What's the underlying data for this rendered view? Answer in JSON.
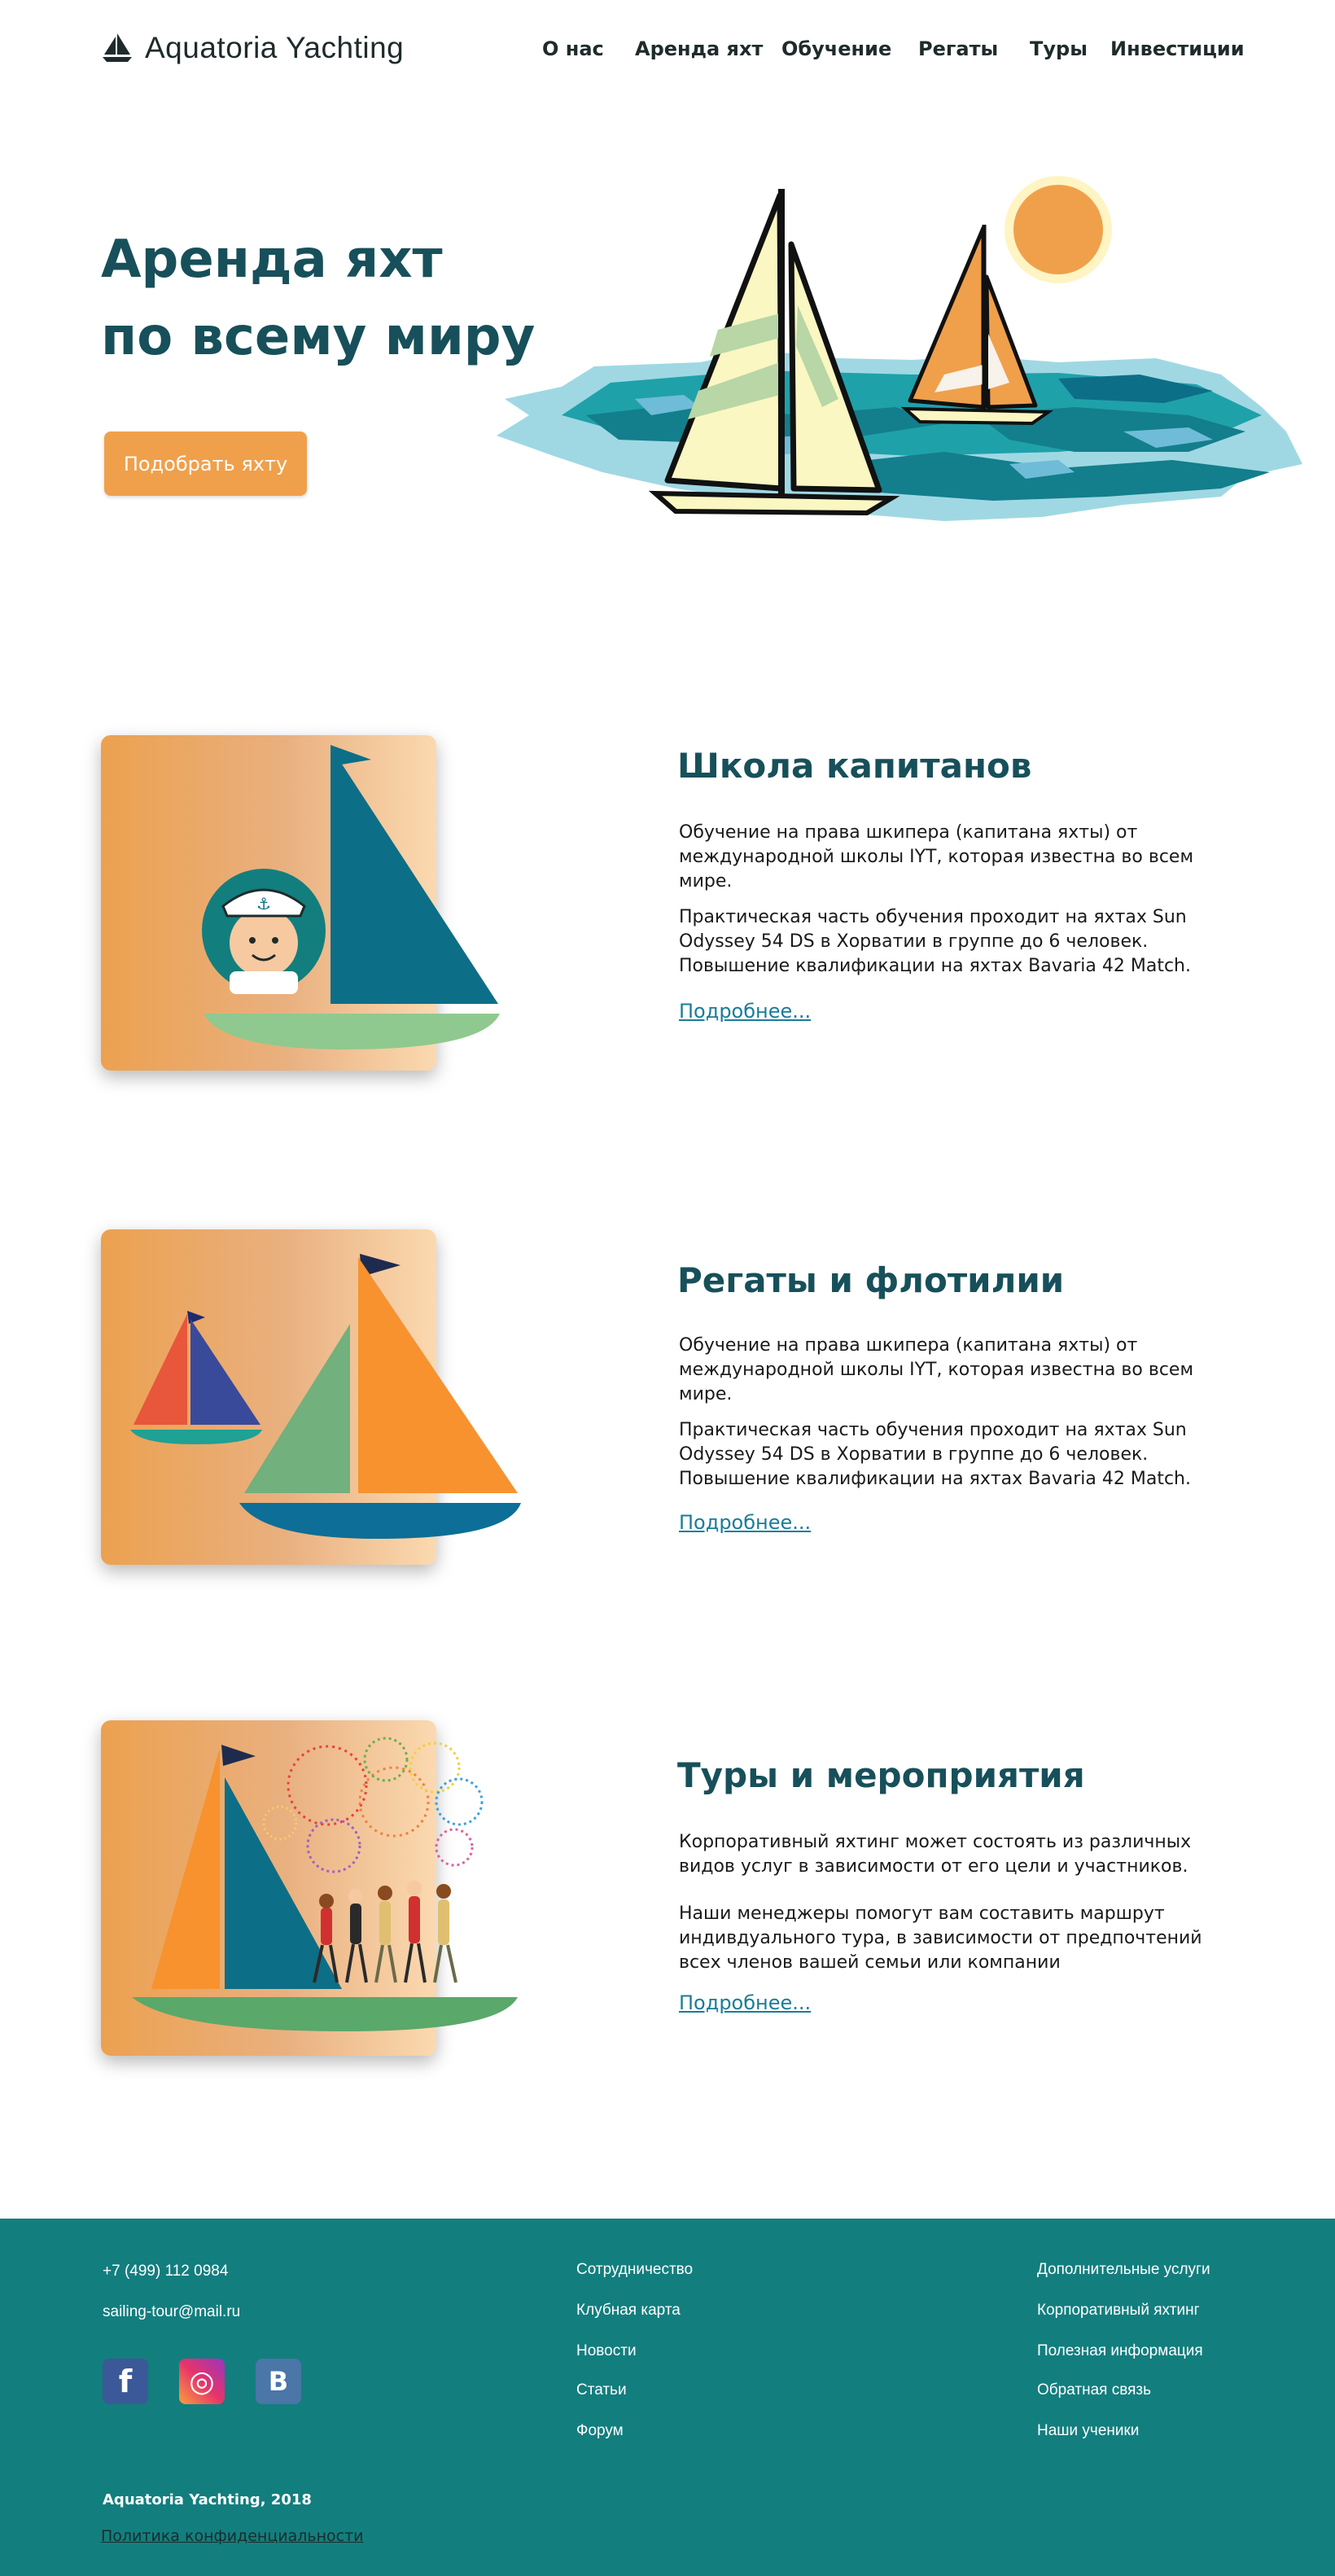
{
  "header": {
    "logo_text": "Aquatoria Yachting",
    "nav": [
      "О нас",
      "Аренда яхт",
      "Обучение",
      "Регаты",
      "Туры",
      "Инвестиции"
    ]
  },
  "hero": {
    "title_line1": "Аренда яхт",
    "title_line2": "по всему миру",
    "button": "Подобрать яхту"
  },
  "sections": [
    {
      "title": "Школа капитанов",
      "paragraphs": [
        "Обучение на права шкипера (капитана яхты) от международной школы IYT, которая известна во всем мире.",
        "Практическая часть обучения проходит на яхтах Sun Odyssey 54 DS в Хорватии в группе до 6 человек. Повышение квалификации на яхтах Bavaria 42 Match."
      ],
      "link": "Подробнее..."
    },
    {
      "title": "Регаты и флотилии",
      "paragraphs": [
        "Обучение на права шкипера (капитана яхты) от международной школы IYT, которая известна во всем мире.",
        "Практическая часть обучения проходит на яхтах Sun Odyssey 54 DS в Хорватии в группе до 6 человек. Повышение квалификации на яхтах Bavaria 42 Match."
      ],
      "link": "Подробнее..."
    },
    {
      "title": "Туры и мероприятия",
      "paragraphs": [
        "Корпоративный яхтинг может состоять из различных видов услуг в зависимости от его цели и участников.",
        "Наши менеджеры помогут вам составить маршрут индивдуального тура, в зависимости от предпочтений всех членов вашей семьи или компании"
      ],
      "link": "Подробнее..."
    }
  ],
  "footer": {
    "phone": "+7 (499) 112 0984",
    "email": "sailing-tour@mail.ru",
    "social": [
      {
        "label": "f",
        "icon": "facebook-icon",
        "color": "#3b5998"
      },
      {
        "label": "◎",
        "icon": "instagram-icon",
        "color": "#d6249f"
      },
      {
        "label": "B",
        "icon": "vk-icon",
        "color": "#4a76a8"
      }
    ],
    "col2": [
      "Сотрудничество",
      "Клубная карта",
      "Новости",
      "Статьи",
      "Форум"
    ],
    "col3": [
      "Дополнительные услуги",
      "Корпоративный яхтинг",
      "Полезная информация",
      "Обратная связь",
      "Наши ученики"
    ],
    "copyright": "Aquatoria Yachting, 2018",
    "policy": "Политика конфиденциальности"
  },
  "colors": {
    "accent": "#f0a04b",
    "heading": "#17505a",
    "footer_bg": "#137e7e",
    "link": "#1a7c9a"
  }
}
